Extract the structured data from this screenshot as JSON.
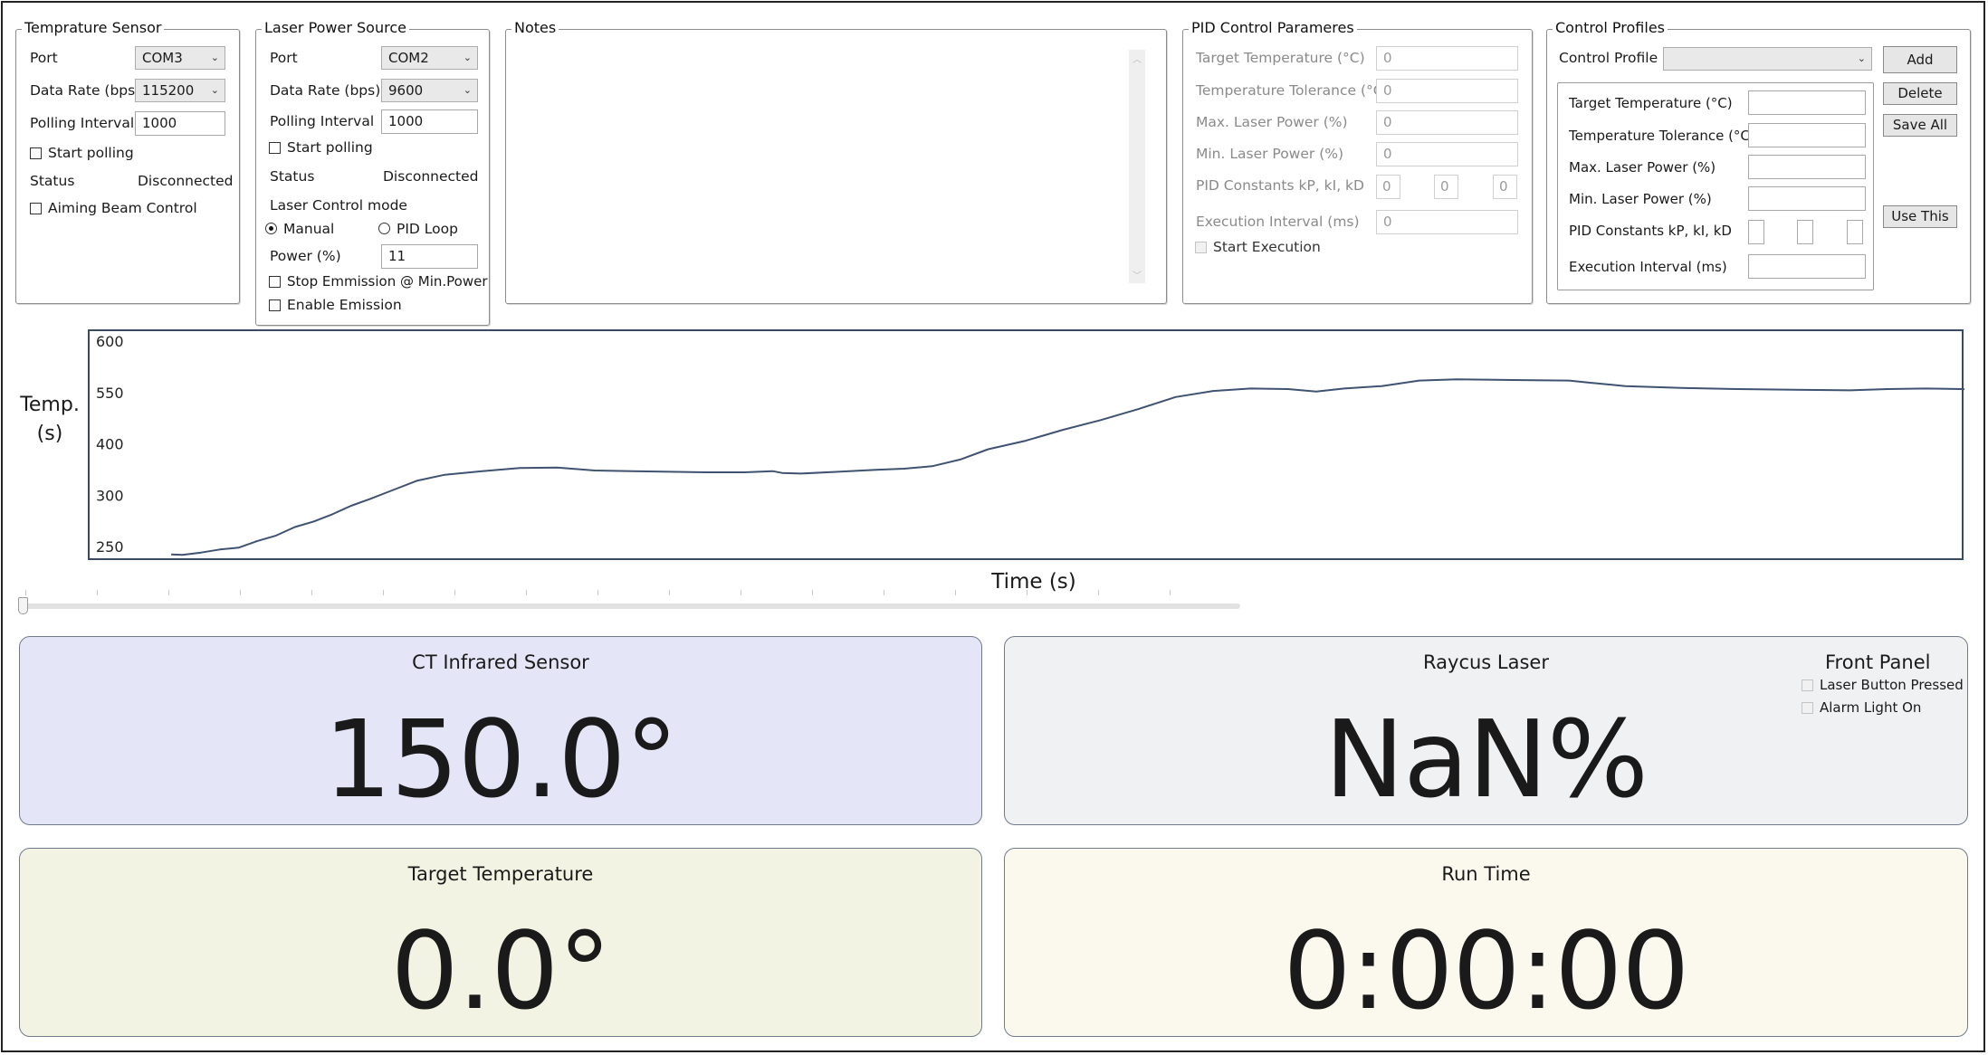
{
  "temp_sensor": {
    "title": "Temprature Sensor",
    "port_label": "Port",
    "port_value": "COM3",
    "rate_label": "Data Rate (bps)",
    "rate_value": "115200",
    "interval_label": "Polling Interval",
    "interval_value": "1000",
    "start_polling": "Start polling",
    "status_label": "Status",
    "status_value": "Disconnected",
    "aiming": "Aiming Beam Control"
  },
  "laser_source": {
    "title": "Laser Power Source",
    "port_label": "Port",
    "port_value": "COM2",
    "rate_label": "Data Rate (bps)",
    "rate_value": "9600",
    "interval_label": "Polling Interval",
    "interval_value": "1000",
    "start_polling": "Start polling",
    "status_label": "Status",
    "status_value": "Disconnected",
    "mode_label": "Laser Control mode",
    "manual": "Manual",
    "pid_loop": "PID Loop",
    "power_label": "Power (%)",
    "power_value": "11",
    "stop_emission": "Stop Emmission @ Min.Power",
    "enable_emission": "Enable Emission"
  },
  "notes": {
    "title": "Notes"
  },
  "pid": {
    "title": "PID Control Parameres",
    "target_label": "Target Temperature (°C)",
    "target_value": "0",
    "tolerance_label": "Temperature Tolerance (°C)",
    "tolerance_value": "0",
    "max_label": "Max. Laser Power (%)",
    "max_value": "0",
    "min_label": "Min. Laser Power (%)",
    "min_value": "0",
    "constants_label": "PID Constants kP, kI, kD",
    "kp": "0",
    "ki": "0",
    "kd": "0",
    "exec_label": "Execution Interval (ms)",
    "exec_value": "0",
    "start_exec": "Start Execution"
  },
  "profiles": {
    "title": "Control Profiles",
    "profile_label": "Control Profile",
    "profile_value": "",
    "add": "Add",
    "delete": "Delete",
    "save_all": "Save All",
    "use_this": "Use This",
    "target_label": "Target Temperature (°C)",
    "tolerance_label": "Temperature Tolerance (°C)",
    "max_label": "Max. Laser Power (%)",
    "min_label": "Min. Laser Power (%)",
    "constants_label": "PID Constants kP, kI, kD",
    "exec_label": "Execution Interval (ms)"
  },
  "chart_data": {
    "type": "line",
    "ylabel_line1": "Temp.",
    "ylabel_line2": "(s)",
    "xlabel": "Time (s)",
    "y_tick_labels": [
      "600",
      "550",
      "400",
      "300",
      "250"
    ],
    "xlim": [
      0,
      100
    ],
    "ylim": [
      250,
      600
    ],
    "grid": false,
    "series": [
      {
        "values": [
          [
            4.4,
            249
          ],
          [
            5.0,
            248
          ],
          [
            6.0,
            252
          ],
          [
            7.0,
            257
          ],
          [
            8.0,
            260
          ],
          [
            9.0,
            271
          ],
          [
            10.0,
            280
          ],
          [
            11.0,
            294
          ],
          [
            12.0,
            303
          ],
          [
            13.0,
            315
          ],
          [
            14.0,
            329
          ],
          [
            15.0,
            340
          ],
          [
            16.0,
            352
          ],
          [
            17.5,
            370
          ],
          [
            19.0,
            380
          ],
          [
            21.0,
            386
          ],
          [
            23.0,
            391
          ],
          [
            25.0,
            392
          ],
          [
            27.0,
            387
          ],
          [
            29.0,
            386
          ],
          [
            31.0,
            385
          ],
          [
            33.0,
            384
          ],
          [
            35.0,
            384
          ],
          [
            36.5,
            386
          ],
          [
            37.0,
            383
          ],
          [
            38.0,
            382
          ],
          [
            40.0,
            385
          ],
          [
            42.0,
            388
          ],
          [
            43.5,
            390
          ],
          [
            45.0,
            394
          ],
          [
            46.5,
            405
          ],
          [
            48.0,
            422
          ],
          [
            50.0,
            436
          ],
          [
            52.0,
            454
          ],
          [
            54.0,
            470
          ],
          [
            56.0,
            488
          ],
          [
            58.0,
            508
          ],
          [
            60.0,
            518
          ],
          [
            62.0,
            522
          ],
          [
            64.0,
            521
          ],
          [
            65.5,
            517
          ],
          [
            67.0,
            522
          ],
          [
            69.0,
            526
          ],
          [
            71.0,
            535
          ],
          [
            73.0,
            537
          ],
          [
            76.0,
            536
          ],
          [
            79.0,
            535
          ],
          [
            80.0,
            532
          ],
          [
            82.0,
            526
          ],
          [
            85.0,
            523
          ],
          [
            88.0,
            521
          ],
          [
            91.0,
            520
          ],
          [
            94.0,
            519
          ],
          [
            96.0,
            521
          ],
          [
            98.0,
            522
          ],
          [
            100.0,
            521
          ],
          [
            101.0,
            520
          ]
        ]
      }
    ]
  },
  "slider": {
    "value": 0
  },
  "cards": {
    "ct_title": "CT Infrared Sensor",
    "ct_value": "150.0°",
    "laser_title": "Raycus Laser",
    "laser_value": "NaN%",
    "front_panel": "Front Panel",
    "laser_button": "Laser Button Pressed",
    "alarm_light": "Alarm Light On",
    "target_title": "Target Temperature",
    "target_value": "0.0°",
    "runtime_title": "Run Time",
    "runtime_value": "0:00:00"
  },
  "colors": {
    "ct_card": "#e4e6f7",
    "laser_card": "#f0f1f3",
    "target_card": "#f3f3e3",
    "runtime_card": "#fbf9ee",
    "chart_line": "#3f5272"
  }
}
